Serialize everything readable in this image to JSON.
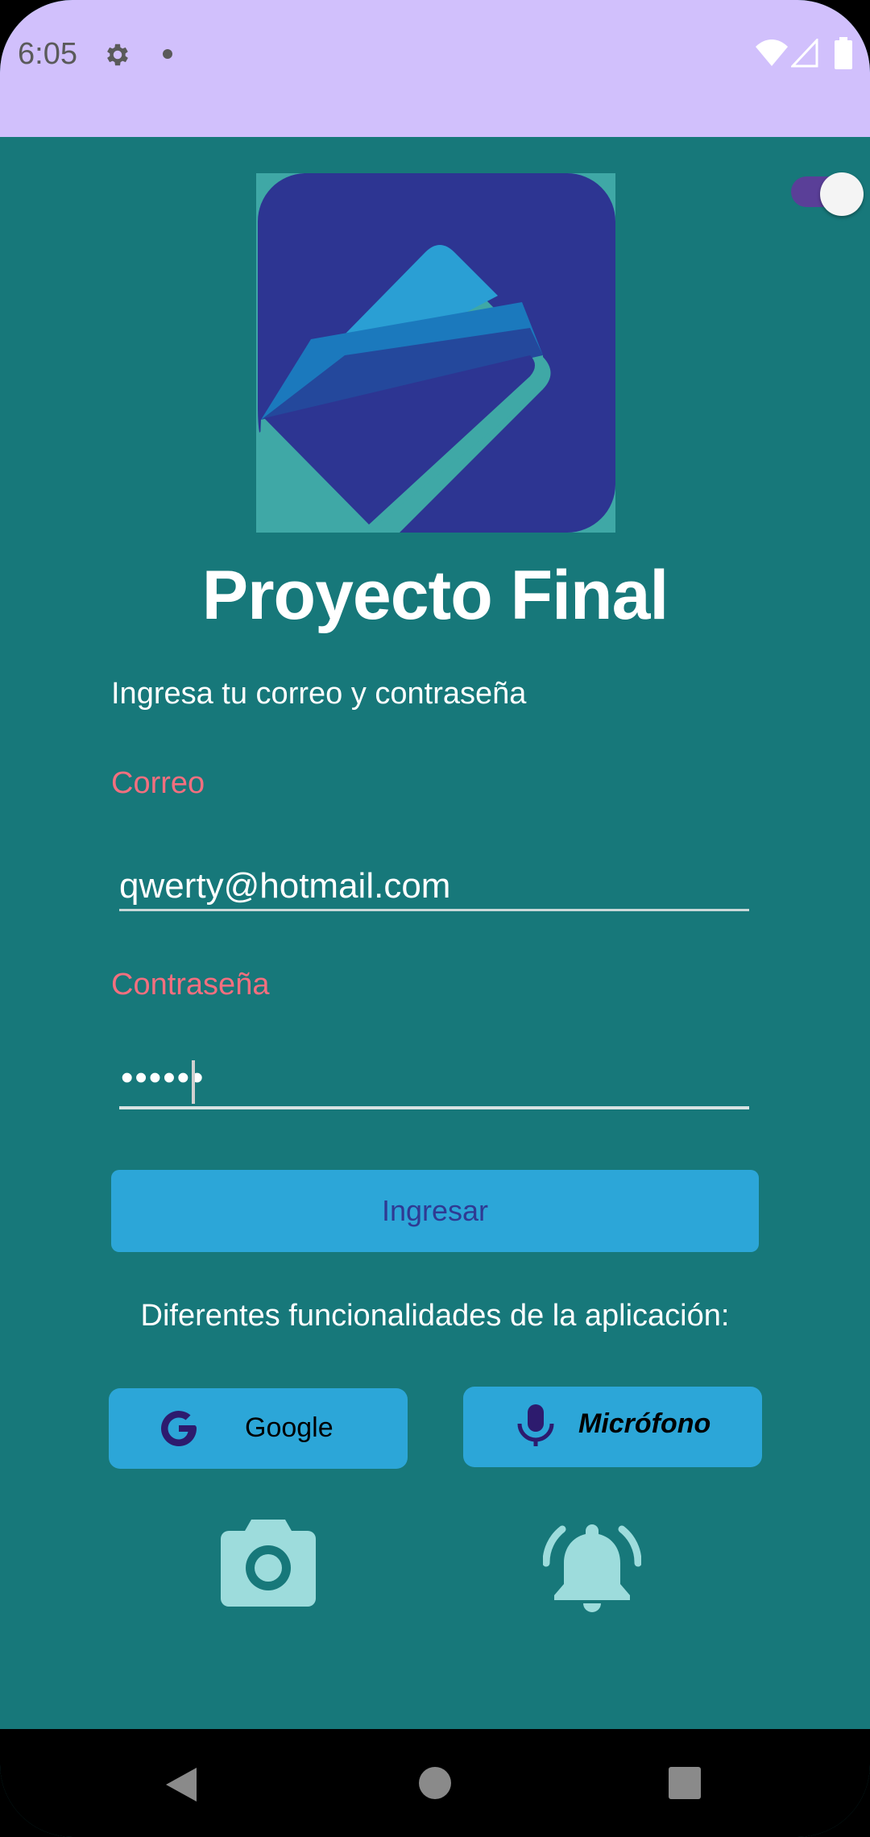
{
  "status_bar": {
    "time": "6:05",
    "icons": [
      "gear-icon",
      "notification-dot-icon",
      "wifi-icon",
      "signal-icon",
      "battery-icon"
    ]
  },
  "app": {
    "title": "Proyecto Final",
    "subtitle": "Ingresa tu correo y contraseña",
    "theme_toggle_on": true
  },
  "form": {
    "email_label": "Correo",
    "email_value": "qwerty@hotmail.com",
    "password_label": "Contraseña",
    "password_masked": "••••••",
    "login_button": "Ingresar"
  },
  "features": {
    "heading": "Diferentes funcionalidades de la aplicación:",
    "google_button": "Google",
    "mic_button": "Micrófono",
    "icons": [
      "camera-icon",
      "bell-ringing-icon"
    ]
  },
  "nav_bar": {
    "icons": [
      "back-icon",
      "home-icon",
      "recents-icon"
    ]
  },
  "colors": {
    "status_bar": "#d1c0fc",
    "background": "#17787a",
    "accent_button": "#2ca6d8",
    "label": "#f36f7f",
    "button_text": "#2f3a93",
    "icon_light": "#9ddcdc"
  }
}
